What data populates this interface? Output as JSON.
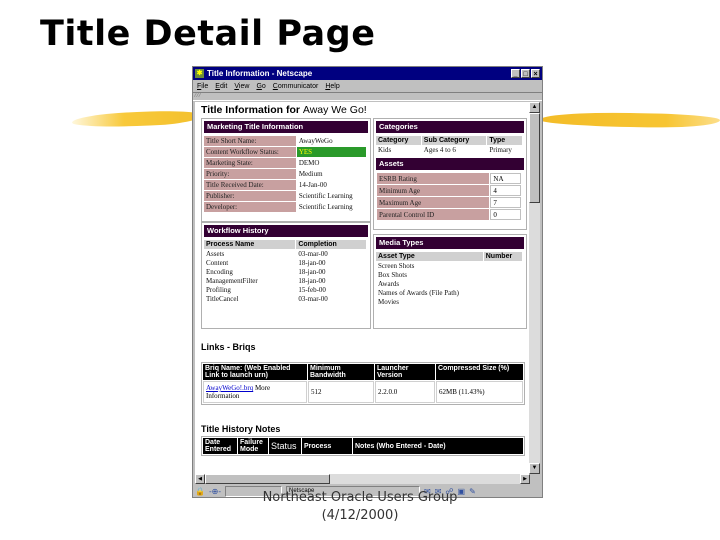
{
  "slide": {
    "title": "Title Detail Page",
    "footer_line1": "Northeast Oracle Users Group",
    "footer_line2": "(4/12/2000)"
  },
  "window": {
    "title": "Title Information - Netscape",
    "controls": [
      "_",
      "□",
      "×"
    ],
    "menu": [
      "File",
      "Edit",
      "View",
      "Go",
      "Communicator",
      "Help"
    ],
    "status_text": "Netscape"
  },
  "page": {
    "heading_prefix": "Title Information for",
    "heading_title": "Away We Go!",
    "marketing": {
      "header": "Marketing Title Information",
      "rows": [
        {
          "label": "Title Short Name:",
          "value": "AwayWeGo"
        },
        {
          "label": "Content Workflow Status:",
          "value": "YES",
          "status_color": "#2a9a2a"
        },
        {
          "label": "Marketing State:",
          "value": "DEMO"
        },
        {
          "label": "Priority:",
          "value": "Medium"
        },
        {
          "label": "Title Received Date:",
          "value": "14-Jan-00"
        },
        {
          "label": "Publisher:",
          "value": "Scientific Learning"
        },
        {
          "label": "Developer:",
          "value": "Scientific Learning"
        }
      ]
    },
    "categories": {
      "header": "Categories",
      "columns": [
        "Category",
        "Sub Category",
        "Type"
      ],
      "rows": [
        [
          "Kids",
          "Ages 4 to 6",
          "Primary"
        ]
      ]
    },
    "assets": {
      "header": "Assets",
      "rows": [
        {
          "label": "ESRB Rating",
          "value": "NA"
        },
        {
          "label": "Minimum Age",
          "value": "4"
        },
        {
          "label": "Maximum Age",
          "value": "7"
        },
        {
          "label": "Parental Control ID",
          "value": "0"
        }
      ]
    },
    "workflow": {
      "header": "Workflow History",
      "columns": [
        "Process Name",
        "Completion"
      ],
      "rows": [
        [
          "Assets",
          "03-mar-00"
        ],
        [
          "Content",
          "18-jan-00"
        ],
        [
          "Encoding",
          "18-jan-00"
        ],
        [
          "ManagementFilter",
          "18-jan-00"
        ],
        [
          "Profiling",
          "15-feb-00"
        ],
        [
          "TitleCancel",
          "03-mar-00"
        ]
      ]
    },
    "media": {
      "header": "Media Types",
      "columns": [
        "Asset Type",
        "Number"
      ],
      "rows": [
        "Screen Shots",
        "Box Shots",
        "Awards",
        "Names of Awards (File Path)",
        "Movies"
      ]
    },
    "links": {
      "header": "Links - Briqs",
      "columns": [
        "Briq Name: (Web Enabled Link to launch urn)",
        "Minimum Bandwidth",
        "Launcher Version",
        "Compressed Size (%)"
      ],
      "row": {
        "link": "AwayWeGo!.brq",
        "link_suffix": "More Information",
        "bandwidth": "512",
        "launcher": "2.2.0.0",
        "size": "62MB (11.43%)"
      }
    },
    "history": {
      "header": "Title History Notes",
      "columns": [
        "Date Entered",
        "Failure Mode",
        "Status",
        "Process",
        "Notes (Who Entered - Date)"
      ]
    }
  },
  "colors": {
    "panel_header": "#330033",
    "label_bg": "#c8a0a0",
    "status_green": "#2a9a2a",
    "titlebar": "#000080",
    "highlighter": "#f5c22e"
  }
}
